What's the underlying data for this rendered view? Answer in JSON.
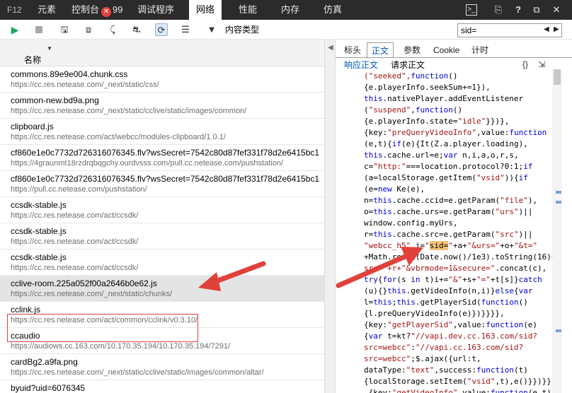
{
  "top_tabs": {
    "f12": "F12",
    "elements": "元素",
    "console": "控制台",
    "console_errors": "99",
    "debugger": "调试程序",
    "network": "网络",
    "performance": "性能",
    "memory": "内存",
    "emulation": "仿真"
  },
  "toolbar": {
    "content_type": "内容类型",
    "search_value": "sid="
  },
  "list": {
    "column_name": "名称",
    "rows": [
      {
        "name": "commons.89e9e004.chunk.css",
        "url": "https://cc.res.netease.com/_next/static/css/"
      },
      {
        "name": "common-new.bd9a.png",
        "url": "https://cc.res.netease.com/_next/static/cclive/static/images/common/"
      },
      {
        "name": "clipboard.js",
        "url": "https://cc.res.netease.com/act/webcc/modules-clipboard/1.0.1/"
      },
      {
        "name": "cf860e1e0c7732d726316076345.flv?wsSecret=7542c80d87fef331f78d2e6415bc1",
        "url": "https://4graunmt18rzdrqbqgchy.ourdvsss.com/pull.cc.netease.com/pushstation/"
      },
      {
        "name": "cf860e1e0c7732d726316076345.flv?wsSecret=7542c80d87fef331f78d2e6415bc1",
        "url": "https://pull.cc.netease.com/pushstation/"
      },
      {
        "name": "ccsdk-stable.js",
        "url": "https://cc.res.netease.com/act/ccsdk/"
      },
      {
        "name": "ccsdk-stable.js",
        "url": "https://cc.res.netease.com/act/ccsdk/"
      },
      {
        "name": "ccsdk-stable.js",
        "url": "https://cc.res.netease.com/act/ccsdk/"
      },
      {
        "name": "cclive-room.225a052f00a2646b0e62.js",
        "url": "https://cc.res.netease.com/_next/static/chunks/"
      },
      {
        "name": "cclink.js",
        "url": "https://cc.res.netease.com/act/common/cclink/v0.3.10/"
      },
      {
        "name": "ccaudio",
        "url": "https://audiows.cc.163.com/10.170.35.194/10.170.35.194/7291/"
      },
      {
        "name": "cardBg2.a9fa.png",
        "url": "https://cc.res.netease.com/_next/static/cclive/static/images/common/altar/"
      },
      {
        "name": "byuid?uid=6076345",
        "url": ""
      }
    ]
  },
  "detail": {
    "tabs": [
      "标头",
      "正文",
      "参数",
      "Cookie",
      "计时"
    ],
    "subtab_response": "响应正文",
    "subtab_request": "请求正文"
  },
  "code_lines": [
    [
      [
        "s",
        "(\"seeked\","
      ],
      [
        "k",
        "function"
      ],
      [
        "",
        "()"
      ]
    ],
    [
      [
        "",
        "{e.playerInfo.seekSum+=1}),"
      ]
    ],
    [
      [
        "k",
        "this"
      ],
      [
        "",
        ".nativePlayer.addEventListener"
      ]
    ],
    [
      [
        "",
        "("
      ],
      [
        "s",
        "\"suspend\""
      ],
      [
        "",
        ","
      ],
      [
        "k",
        "function"
      ],
      [
        "",
        "()"
      ]
    ],
    [
      [
        "",
        "{e.playerInfo.state="
      ],
      [
        "s",
        "\"idle\""
      ],
      [
        "",
        "}})},"
      ]
    ],
    [
      [
        "",
        "{key:"
      ],
      [
        "s",
        "\"preQueryVideoInfo\""
      ],
      [
        "",
        ",value:"
      ],
      [
        "k",
        "function"
      ]
    ],
    [
      [
        "",
        "(e,t){"
      ],
      [
        "k",
        "if"
      ],
      [
        "",
        "(e){It(Z.a.player.loading),"
      ]
    ],
    [
      [
        "k",
        "this"
      ],
      [
        "",
        ".cache.url=e;"
      ],
      [
        "k",
        "var"
      ],
      [
        "",
        " n,i,a,o,r,s,"
      ]
    ],
    [
      [
        "",
        "c="
      ],
      [
        "s",
        "\"http:\""
      ],
      [
        "",
        "===location.protocol?0:1;"
      ],
      [
        "k",
        "if"
      ]
    ],
    [
      [
        "",
        "(a=localStorage.getItem("
      ],
      [
        "s",
        "\"vsid\""
      ],
      [
        "",
        ")){"
      ],
      [
        "k",
        "if"
      ]
    ],
    [
      [
        "",
        "(e="
      ],
      [
        "k",
        "new"
      ],
      [
        "",
        " Ke(e),"
      ]
    ],
    [
      [
        "",
        "n="
      ],
      [
        "k",
        "this"
      ],
      [
        "",
        ".cache.ccid=e.getParam("
      ],
      [
        "s",
        "\"file\""
      ],
      [
        "",
        "),"
      ]
    ],
    [
      [
        "",
        "o="
      ],
      [
        "k",
        "this"
      ],
      [
        "",
        ".cache.urs=e.getParam("
      ],
      [
        "s",
        "\"urs\""
      ],
      [
        "",
        ")||"
      ]
    ],
    [
      [
        "",
        "window.config.myUrs,"
      ]
    ],
    [
      [
        "",
        "r="
      ],
      [
        "k",
        "this"
      ],
      [
        "",
        ".cache.src=e.getParam("
      ],
      [
        "s",
        "\"src\""
      ],
      [
        "",
        ")||"
      ]
    ],
    [
      [
        "s",
        "\"webcc_h5\""
      ],
      [
        "",
        ",i="
      ],
      [
        "s",
        "\""
      ],
      [
        "hl",
        "sid="
      ],
      [
        "s",
        "\""
      ],
      [
        "",
        "+a+"
      ],
      [
        "s",
        "\"&urs=\""
      ],
      [
        "",
        "+o+"
      ],
      [
        "s",
        "\"&t=\""
      ]
    ],
    [
      [
        "",
        "+Math.round(Date.now()/1e3).toString(16)+"
      ],
      [
        "s",
        "\"&"
      ]
    ],
    [
      [
        "s",
        "src=\"+r+\"&vbrmode=1&secure=\""
      ],
      [
        "",
        ".concat(c),"
      ]
    ],
    [
      [
        "s",
        ""
      ],
      [
        "k",
        "try"
      ],
      [
        "",
        "{"
      ],
      [
        "k",
        "for"
      ],
      [
        "",
        "(s "
      ],
      [
        "k",
        "in"
      ],
      [
        "",
        " t)i+="
      ],
      [
        "s",
        "\"&\""
      ],
      [
        "",
        "+s+"
      ],
      [
        "s",
        "\"=\""
      ],
      [
        "",
        "+t[s]}"
      ],
      [
        "k",
        "catch"
      ]
    ],
    [
      [
        "",
        "(u){}"
      ],
      [
        "k",
        "this"
      ],
      [
        "",
        ".getVideoInfo(n,i)}"
      ],
      [
        "k",
        "else"
      ],
      [
        "",
        "{"
      ],
      [
        "k",
        "var"
      ]
    ],
    [
      [
        "",
        "l="
      ],
      [
        "k",
        "this"
      ],
      [
        "",
        ";"
      ],
      [
        "k",
        "this"
      ],
      [
        "",
        ".getPlayerSid("
      ],
      [
        "k",
        "function"
      ],
      [
        "",
        "()"
      ]
    ],
    [
      [
        "",
        "{l.preQueryVideoInfo(e)})}}}},"
      ]
    ],
    [
      [
        "",
        "{key:"
      ],
      [
        "s",
        "\"getPlayerSid\""
      ],
      [
        "",
        ",value:"
      ],
      [
        "k",
        "function"
      ],
      [
        "",
        "(e)"
      ]
    ],
    [
      [
        "",
        "{"
      ],
      [
        "k",
        "var"
      ],
      [
        "",
        " t=kt?"
      ],
      [
        "s",
        "\"//vapi.dev.cc.163.com/sid?"
      ]
    ],
    [
      [
        "s",
        "src=webcc\""
      ],
      [
        "",
        ":"
      ],
      [
        "s",
        "\"//vapi.cc.163.com/sid?"
      ]
    ],
    [
      [
        "s",
        "src=webcc\""
      ],
      [
        "",
        ";$.ajax({url:t,"
      ]
    ],
    [
      [
        "",
        "dataType:"
      ],
      [
        "s",
        "\"text\""
      ],
      [
        "",
        ",success:"
      ],
      [
        "k",
        "function"
      ],
      [
        "",
        "(t)"
      ]
    ],
    [
      [
        "",
        "{localStorage.setItem("
      ],
      [
        "s",
        "\"vsid\""
      ],
      [
        "",
        ",t),e()}})}}"
      ]
    ],
    [
      [
        "",
        ",{key:"
      ],
      [
        "s",
        "\"getVideoInfo\""
      ],
      [
        "",
        ",value:"
      ],
      [
        "k",
        "function"
      ],
      [
        "",
        "(e,t)"
      ]
    ]
  ]
}
